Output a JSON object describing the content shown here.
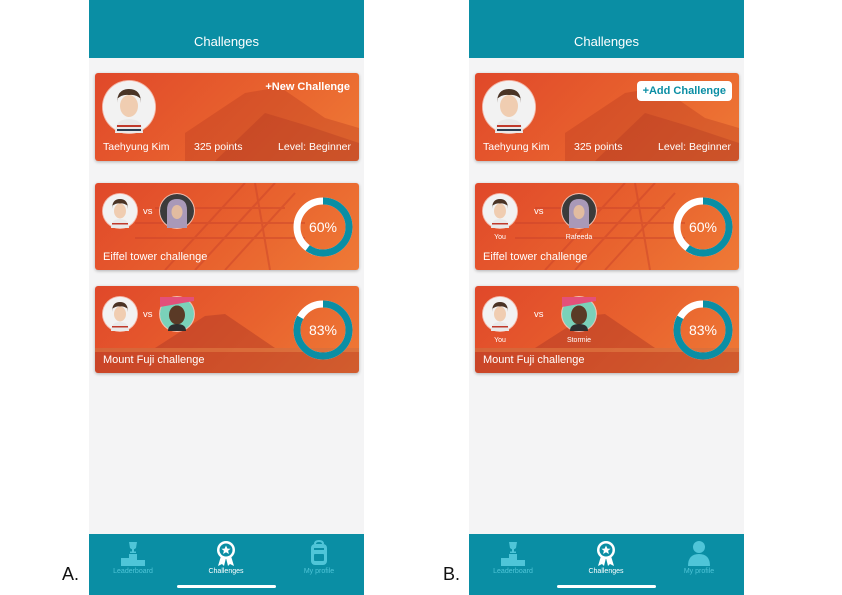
{
  "variants": [
    {
      "letter": "A.",
      "header_title": "Challenges",
      "profile": {
        "name": "Taehyung Kim",
        "points": "325 points",
        "level": "Level: Beginner"
      },
      "action_label": "+New Challenge",
      "challenges": [
        {
          "title": "Eiffel tower challenge",
          "progress_label": "60%",
          "progress": 0.6,
          "vs": "vs",
          "you_label": "",
          "opponent_label": ""
        },
        {
          "title": "Mount Fuji challenge",
          "progress_label": "83%",
          "progress": 0.83,
          "vs": "vs",
          "you_label": "",
          "opponent_label": ""
        }
      ],
      "nav": {
        "leaderboard": "Leaderboard",
        "challenges": "Challenges",
        "profile": "My profile"
      }
    },
    {
      "letter": "B.",
      "header_title": "Challenges",
      "profile": {
        "name": "Taehyung Kim",
        "points": "325 points",
        "level": "Level: Beginner"
      },
      "action_label": "+Add Challenge",
      "challenges": [
        {
          "title": "Eiffel tower challenge",
          "progress_label": "60%",
          "progress": 0.6,
          "vs": "vs",
          "you_label": "You",
          "opponent_label": "Rafeeda"
        },
        {
          "title": "Mount Fuji challenge",
          "progress_label": "83%",
          "progress": 0.83,
          "vs": "vs",
          "you_label": "You",
          "opponent_label": "Stormie"
        }
      ],
      "nav": {
        "leaderboard": "Leaderboard",
        "challenges": "Challenges",
        "profile": "My profile"
      }
    }
  ],
  "colors": {
    "teal": "#0a8ea4",
    "teal_light": "#4fc5d8",
    "card_orange": "#e8622e",
    "background": "#f4f4f5"
  },
  "icons": {
    "leaderboard": "podium-trophy-icon",
    "challenges": "medal-star-icon",
    "profile_a": "backpack-icon",
    "profile_b": "person-icon"
  }
}
